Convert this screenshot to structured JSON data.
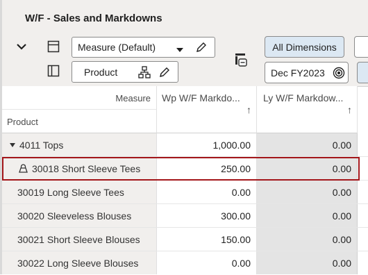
{
  "window": {
    "title": "W/F - Sales and Markdowns"
  },
  "toolbar": {
    "measure_select": "Measure (Default)",
    "product_select": "Product",
    "all_dimensions_label": "All Dimensions",
    "date_select": "Dec FY2023"
  },
  "grid": {
    "header": {
      "measure_label": "Measure",
      "product_label": "Product",
      "col1_label": "Wp W/F Markdo...",
      "col2_label": "Ly W/F Markdow...",
      "sort_arrow": "↑"
    },
    "rows": [
      {
        "label": "4011 Tops",
        "wp": "1,000.00",
        "ly": "0.00"
      },
      {
        "label": "30018 Short Sleeve Tees",
        "wp": "250.00",
        "ly": "0.00"
      },
      {
        "label": "30019 Long Sleeve Tees",
        "wp": "0.00",
        "ly": "0.00"
      },
      {
        "label": "30020 Sleeveless Blouses",
        "wp": "300.00",
        "ly": "0.00"
      },
      {
        "label": "30021 Short Sleeve Blouses",
        "wp": "150.00",
        "ly": "0.00"
      },
      {
        "label": "30022 Long Sleeve Blouses",
        "wp": "0.00",
        "ly": "0.00"
      }
    ]
  },
  "colors": {
    "highlight": "#a3161a",
    "panel": "#f1efed",
    "readonly_cell": "#e4e4e4",
    "selected_pill": "#dce8f3"
  }
}
